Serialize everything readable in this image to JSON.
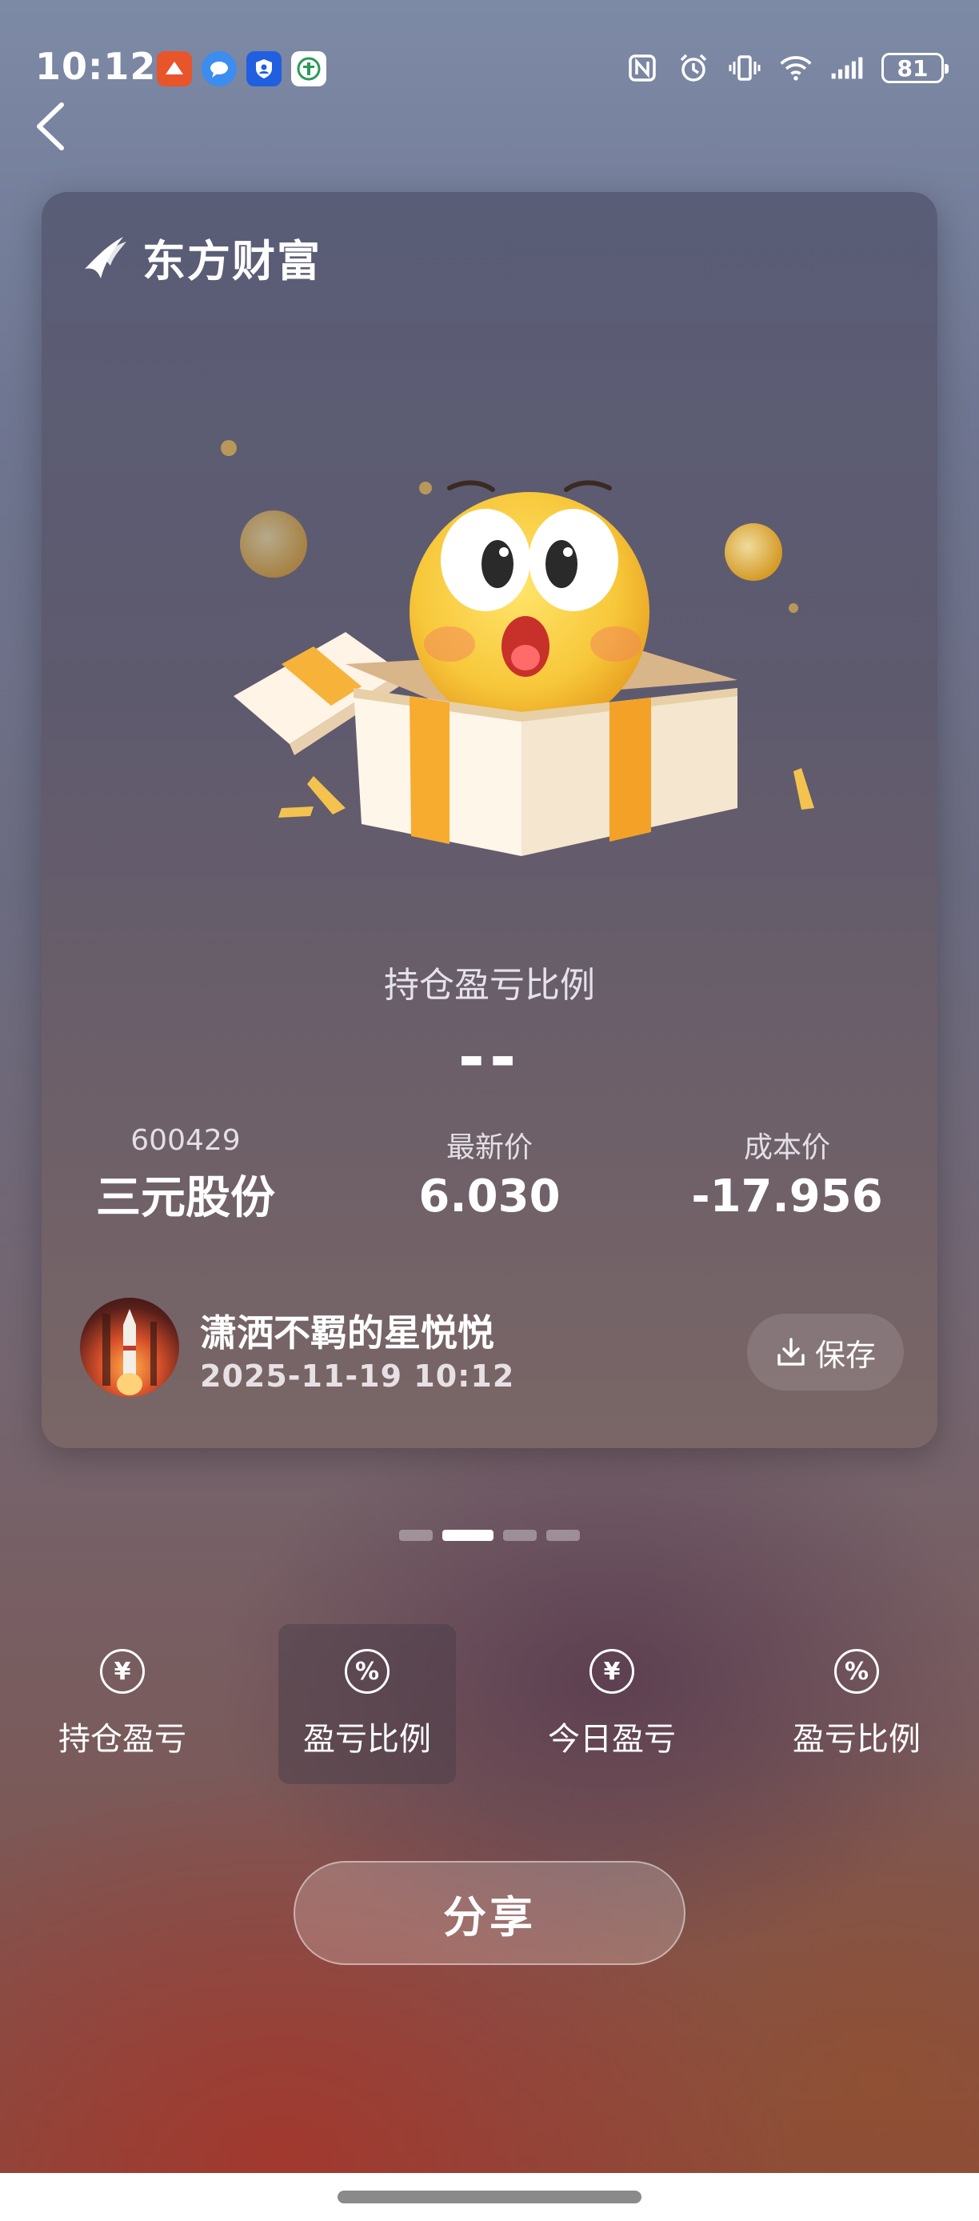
{
  "status_bar": {
    "time": "10:12",
    "battery": "81",
    "notification_icons": [
      "app-orange-icon",
      "chat-bubble-icon",
      "shield-user-icon",
      "bank-icon"
    ],
    "system_icons": [
      "nfc-icon",
      "alarm-icon",
      "vibrate-icon",
      "wifi-icon",
      "signal-icon",
      "battery-icon"
    ]
  },
  "card": {
    "brand": "东方财富",
    "ratio_label": "持仓盈亏比例",
    "ratio_value": "--",
    "stats": [
      {
        "label": "600429",
        "value": "三元股份"
      },
      {
        "label": "最新价",
        "value": "6.030"
      },
      {
        "label": "成本价",
        "value": "-17.956"
      }
    ],
    "user": {
      "name": "潇洒不羁的星悦悦",
      "time": "2025-11-19 10:12"
    },
    "save_label": "保存"
  },
  "pager": {
    "count": 4,
    "active_index": 1
  },
  "options": [
    {
      "icon": "yuan-icon",
      "glyph": "¥",
      "label": "持仓盈亏",
      "selected": false
    },
    {
      "icon": "percent-icon",
      "glyph": "%",
      "label": "盈亏比例",
      "selected": true
    },
    {
      "icon": "yuan-icon",
      "glyph": "¥",
      "label": "今日盈亏",
      "selected": false
    },
    {
      "icon": "percent-icon",
      "glyph": "%",
      "label": "盈亏比例",
      "selected": false
    }
  ],
  "share_label": "分享"
}
